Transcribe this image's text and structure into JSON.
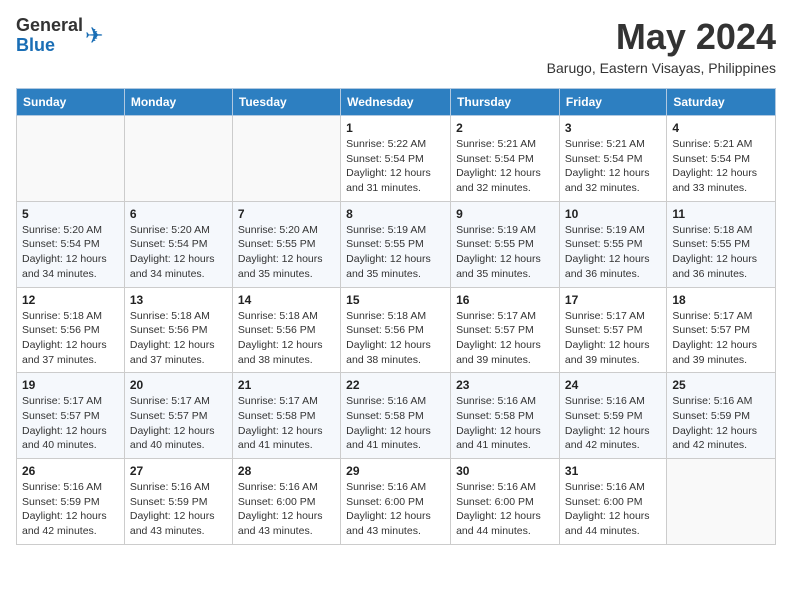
{
  "header": {
    "logo_general": "General",
    "logo_blue": "Blue",
    "month_year": "May 2024",
    "location": "Barugo, Eastern Visayas, Philippines"
  },
  "days_of_week": [
    "Sunday",
    "Monday",
    "Tuesday",
    "Wednesday",
    "Thursday",
    "Friday",
    "Saturday"
  ],
  "weeks": [
    [
      {
        "num": "",
        "info": ""
      },
      {
        "num": "",
        "info": ""
      },
      {
        "num": "",
        "info": ""
      },
      {
        "num": "1",
        "info": "Sunrise: 5:22 AM\nSunset: 5:54 PM\nDaylight: 12 hours\nand 31 minutes."
      },
      {
        "num": "2",
        "info": "Sunrise: 5:21 AM\nSunset: 5:54 PM\nDaylight: 12 hours\nand 32 minutes."
      },
      {
        "num": "3",
        "info": "Sunrise: 5:21 AM\nSunset: 5:54 PM\nDaylight: 12 hours\nand 32 minutes."
      },
      {
        "num": "4",
        "info": "Sunrise: 5:21 AM\nSunset: 5:54 PM\nDaylight: 12 hours\nand 33 minutes."
      }
    ],
    [
      {
        "num": "5",
        "info": "Sunrise: 5:20 AM\nSunset: 5:54 PM\nDaylight: 12 hours\nand 34 minutes."
      },
      {
        "num": "6",
        "info": "Sunrise: 5:20 AM\nSunset: 5:54 PM\nDaylight: 12 hours\nand 34 minutes."
      },
      {
        "num": "7",
        "info": "Sunrise: 5:20 AM\nSunset: 5:55 PM\nDaylight: 12 hours\nand 35 minutes."
      },
      {
        "num": "8",
        "info": "Sunrise: 5:19 AM\nSunset: 5:55 PM\nDaylight: 12 hours\nand 35 minutes."
      },
      {
        "num": "9",
        "info": "Sunrise: 5:19 AM\nSunset: 5:55 PM\nDaylight: 12 hours\nand 35 minutes."
      },
      {
        "num": "10",
        "info": "Sunrise: 5:19 AM\nSunset: 5:55 PM\nDaylight: 12 hours\nand 36 minutes."
      },
      {
        "num": "11",
        "info": "Sunrise: 5:18 AM\nSunset: 5:55 PM\nDaylight: 12 hours\nand 36 minutes."
      }
    ],
    [
      {
        "num": "12",
        "info": "Sunrise: 5:18 AM\nSunset: 5:56 PM\nDaylight: 12 hours\nand 37 minutes."
      },
      {
        "num": "13",
        "info": "Sunrise: 5:18 AM\nSunset: 5:56 PM\nDaylight: 12 hours\nand 37 minutes."
      },
      {
        "num": "14",
        "info": "Sunrise: 5:18 AM\nSunset: 5:56 PM\nDaylight: 12 hours\nand 38 minutes."
      },
      {
        "num": "15",
        "info": "Sunrise: 5:18 AM\nSunset: 5:56 PM\nDaylight: 12 hours\nand 38 minutes."
      },
      {
        "num": "16",
        "info": "Sunrise: 5:17 AM\nSunset: 5:57 PM\nDaylight: 12 hours\nand 39 minutes."
      },
      {
        "num": "17",
        "info": "Sunrise: 5:17 AM\nSunset: 5:57 PM\nDaylight: 12 hours\nand 39 minutes."
      },
      {
        "num": "18",
        "info": "Sunrise: 5:17 AM\nSunset: 5:57 PM\nDaylight: 12 hours\nand 39 minutes."
      }
    ],
    [
      {
        "num": "19",
        "info": "Sunrise: 5:17 AM\nSunset: 5:57 PM\nDaylight: 12 hours\nand 40 minutes."
      },
      {
        "num": "20",
        "info": "Sunrise: 5:17 AM\nSunset: 5:57 PM\nDaylight: 12 hours\nand 40 minutes."
      },
      {
        "num": "21",
        "info": "Sunrise: 5:17 AM\nSunset: 5:58 PM\nDaylight: 12 hours\nand 41 minutes."
      },
      {
        "num": "22",
        "info": "Sunrise: 5:16 AM\nSunset: 5:58 PM\nDaylight: 12 hours\nand 41 minutes."
      },
      {
        "num": "23",
        "info": "Sunrise: 5:16 AM\nSunset: 5:58 PM\nDaylight: 12 hours\nand 41 minutes."
      },
      {
        "num": "24",
        "info": "Sunrise: 5:16 AM\nSunset: 5:59 PM\nDaylight: 12 hours\nand 42 minutes."
      },
      {
        "num": "25",
        "info": "Sunrise: 5:16 AM\nSunset: 5:59 PM\nDaylight: 12 hours\nand 42 minutes."
      }
    ],
    [
      {
        "num": "26",
        "info": "Sunrise: 5:16 AM\nSunset: 5:59 PM\nDaylight: 12 hours\nand 42 minutes."
      },
      {
        "num": "27",
        "info": "Sunrise: 5:16 AM\nSunset: 5:59 PM\nDaylight: 12 hours\nand 43 minutes."
      },
      {
        "num": "28",
        "info": "Sunrise: 5:16 AM\nSunset: 6:00 PM\nDaylight: 12 hours\nand 43 minutes."
      },
      {
        "num": "29",
        "info": "Sunrise: 5:16 AM\nSunset: 6:00 PM\nDaylight: 12 hours\nand 43 minutes."
      },
      {
        "num": "30",
        "info": "Sunrise: 5:16 AM\nSunset: 6:00 PM\nDaylight: 12 hours\nand 44 minutes."
      },
      {
        "num": "31",
        "info": "Sunrise: 5:16 AM\nSunset: 6:00 PM\nDaylight: 12 hours\nand 44 minutes."
      },
      {
        "num": "",
        "info": ""
      }
    ]
  ]
}
